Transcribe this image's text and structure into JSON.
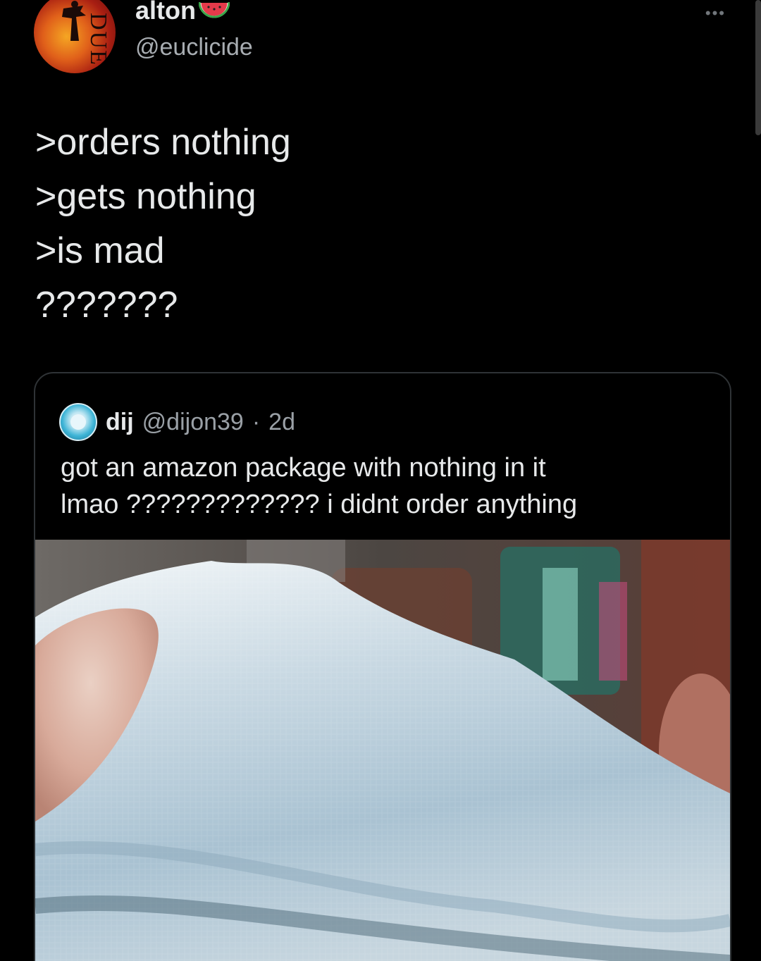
{
  "author": {
    "display_name": "alton",
    "handle": "@euclicide",
    "avatar_text": "DUE"
  },
  "tweet": {
    "lines": [
      ">orders nothing",
      ">gets nothing",
      ">is mad",
      "???????"
    ]
  },
  "quoted_tweet": {
    "display_name": "dij",
    "handle": "@dijon39",
    "separator": "·",
    "time": "2d",
    "text_line1": "got an amazon package with nothing in it",
    "text_line2": "lmao ????????????? i didnt order anything"
  },
  "icons": {
    "more": "more-horizontal-icon",
    "emoji": "watermelon-icon"
  },
  "colors": {
    "background": "#000000",
    "text_primary": "#e7e9ea",
    "text_secondary": "#a8adb2",
    "border": "#2f3336"
  }
}
